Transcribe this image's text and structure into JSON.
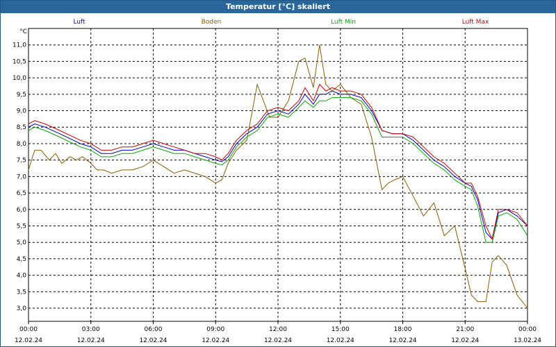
{
  "window": {
    "title": "Temperatur [°C] skaliert"
  },
  "chart_data": {
    "type": "line",
    "title": "Temperatur [°C] skaliert",
    "ylabel": "°C",
    "xlabel": "",
    "ylim": [
      2.6,
      11.5
    ],
    "yticks": [
      "3,0",
      "3,5",
      "4,0",
      "4,5",
      "5,0",
      "5,5",
      "6,0",
      "6,5",
      "7,0",
      "7,5",
      "8,0",
      "8,5",
      "9,0",
      "9,5",
      "10,0",
      "10,5",
      "11,0"
    ],
    "ytick_values": [
      3,
      3.5,
      4,
      4.5,
      5,
      5.5,
      6,
      6.5,
      7,
      7.5,
      8,
      8.5,
      9,
      9.5,
      10,
      10.5,
      11
    ],
    "xlim": [
      0,
      24
    ],
    "xticks": [
      {
        "time": "00:00",
        "date": "12.02.24",
        "h": 0
      },
      {
        "time": "03:00",
        "date": "12.02.24",
        "h": 3
      },
      {
        "time": "06:00",
        "date": "12.02.24",
        "h": 6
      },
      {
        "time": "09:00",
        "date": "12.02.24",
        "h": 9
      },
      {
        "time": "12:00",
        "date": "12.02.24",
        "h": 12
      },
      {
        "time": "15:00",
        "date": "12.02.24",
        "h": 15
      },
      {
        "time": "18:00",
        "date": "12.02.24",
        "h": 18
      },
      {
        "time": "21:00",
        "date": "12.02.24",
        "h": 21
      },
      {
        "time": "00:00",
        "date": "13.02.24",
        "h": 24
      }
    ],
    "grid": true,
    "legend_position": "top",
    "series": [
      {
        "name": "Luft",
        "color": "#0000cc",
        "x": [
          0,
          0.3,
          0.8,
          1.5,
          2.5,
          3,
          3.5,
          4,
          4.5,
          5,
          5.5,
          6,
          6.5,
          7,
          7.5,
          8,
          8.5,
          9,
          9.3,
          9.6,
          10,
          10.5,
          11,
          11.5,
          12,
          12.5,
          13,
          13.3,
          13.7,
          14,
          14.3,
          14.6,
          15,
          15.5,
          16,
          16.5,
          17,
          17.5,
          18,
          18.5,
          19,
          19.5,
          20,
          20.5,
          21,
          21.3,
          21.6,
          22,
          22.3,
          22.6,
          23,
          23.5,
          24
        ],
        "y": [
          8.5,
          8.6,
          8.5,
          8.3,
          8.0,
          7.9,
          7.7,
          7.7,
          7.8,
          7.8,
          7.9,
          8.0,
          7.9,
          7.8,
          7.8,
          7.7,
          7.6,
          7.5,
          7.45,
          7.6,
          8.0,
          8.3,
          8.5,
          8.9,
          9.0,
          8.9,
          9.2,
          9.5,
          9.2,
          9.5,
          9.5,
          9.6,
          9.5,
          9.5,
          9.4,
          9.0,
          8.4,
          8.3,
          8.3,
          8.1,
          7.8,
          7.5,
          7.3,
          7.0,
          6.8,
          6.7,
          6.3,
          5.3,
          5.1,
          5.9,
          6.0,
          5.8,
          5.5
        ]
      },
      {
        "name": "Boden",
        "color": "#8b5a00",
        "x": [
          0,
          0.3,
          0.6,
          1,
          1.3,
          1.6,
          2,
          2.3,
          2.6,
          3,
          3.3,
          3.6,
          4,
          4.5,
          5,
          5.5,
          6,
          6.5,
          7,
          7.5,
          8,
          8.5,
          9,
          9.3,
          9.6,
          10,
          10.5,
          11,
          11.3,
          11.6,
          12,
          12.5,
          13,
          13.3,
          13.7,
          14,
          14.3,
          14.6,
          15,
          15.5,
          16,
          16.5,
          17,
          17.3,
          17.6,
          18,
          18.5,
          19,
          19.5,
          20,
          20.5,
          21,
          21.3,
          21.6,
          22,
          22.3,
          22.6,
          23,
          23.5,
          24
        ],
        "y": [
          7.2,
          7.8,
          7.8,
          7.5,
          7.7,
          7.4,
          7.6,
          7.5,
          7.6,
          7.4,
          7.2,
          7.2,
          7.1,
          7.2,
          7.2,
          7.3,
          7.5,
          7.3,
          7.1,
          7.2,
          7.1,
          7.0,
          6.8,
          6.9,
          7.4,
          7.8,
          8.1,
          9.8,
          9.3,
          8.8,
          8.8,
          9.3,
          10.5,
          10.6,
          9.7,
          11.0,
          9.8,
          9.6,
          9.8,
          9.4,
          9.2,
          8.2,
          6.6,
          6.8,
          6.9,
          7.0,
          6.4,
          5.8,
          6.2,
          5.2,
          5.5,
          4.2,
          3.4,
          3.2,
          3.2,
          4.4,
          4.6,
          4.3,
          3.4,
          3.0
        ]
      },
      {
        "name": "Luft Min",
        "color": "#00aa00",
        "x": [
          0,
          0.3,
          0.8,
          1.5,
          2.5,
          3,
          3.5,
          4,
          4.5,
          5,
          5.5,
          6,
          6.5,
          7,
          7.5,
          8,
          8.5,
          9,
          9.3,
          9.6,
          10,
          10.5,
          11,
          11.5,
          12,
          12.5,
          13,
          13.3,
          13.7,
          14,
          14.3,
          14.6,
          15,
          15.5,
          16,
          16.5,
          17,
          17.5,
          18,
          18.5,
          19,
          19.5,
          20,
          20.5,
          21,
          21.3,
          21.6,
          22,
          22.3,
          22.6,
          23,
          23.5,
          24
        ],
        "y": [
          8.4,
          8.5,
          8.4,
          8.2,
          7.9,
          7.8,
          7.6,
          7.6,
          7.7,
          7.7,
          7.8,
          7.9,
          7.8,
          7.7,
          7.7,
          7.6,
          7.5,
          7.4,
          7.35,
          7.5,
          7.9,
          8.2,
          8.4,
          8.8,
          8.9,
          8.8,
          9.1,
          9.3,
          9.1,
          9.3,
          9.3,
          9.4,
          9.4,
          9.4,
          9.3,
          8.9,
          8.2,
          8.2,
          8.2,
          8.0,
          7.7,
          7.4,
          7.2,
          6.9,
          6.7,
          6.6,
          6.1,
          5.0,
          5.0,
          5.8,
          5.9,
          5.7,
          5.2
        ]
      },
      {
        "name": "Luft Max",
        "color": "#cc0000",
        "x": [
          0,
          0.3,
          0.8,
          1.5,
          2.5,
          3,
          3.5,
          4,
          4.5,
          5,
          5.5,
          6,
          6.5,
          7,
          7.5,
          8,
          8.5,
          9,
          9.3,
          9.6,
          10,
          10.5,
          11,
          11.5,
          12,
          12.5,
          13,
          13.3,
          13.7,
          14,
          14.3,
          14.6,
          15,
          15.5,
          16,
          16.5,
          17,
          17.5,
          18,
          18.5,
          19,
          19.5,
          20,
          20.5,
          21,
          21.3,
          21.6,
          22,
          22.3,
          22.6,
          23,
          23.5,
          24
        ],
        "y": [
          8.6,
          8.7,
          8.6,
          8.4,
          8.1,
          8.0,
          7.8,
          7.8,
          7.9,
          7.9,
          8.0,
          8.1,
          8.0,
          7.9,
          7.8,
          7.7,
          7.7,
          7.6,
          7.5,
          7.7,
          8.1,
          8.4,
          8.6,
          9.0,
          9.1,
          9.0,
          9.3,
          9.7,
          9.3,
          9.8,
          9.6,
          9.7,
          9.6,
          9.6,
          9.5,
          9.1,
          8.4,
          8.3,
          8.3,
          8.2,
          7.9,
          7.6,
          7.4,
          7.1,
          6.8,
          6.8,
          6.4,
          5.5,
          5.1,
          6.0,
          6.0,
          5.9,
          5.5
        ]
      }
    ]
  }
}
